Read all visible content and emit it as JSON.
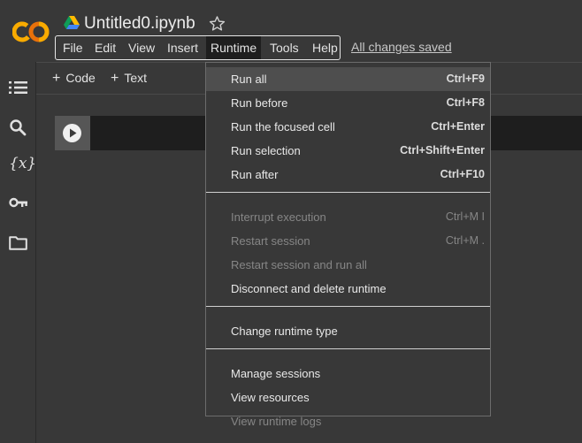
{
  "header": {
    "title": "Untitled0.ipynb",
    "save_status": "All changes saved",
    "menu": [
      "File",
      "Edit",
      "View",
      "Insert",
      "Runtime",
      "Tools",
      "Help"
    ],
    "active_menu": "Runtime"
  },
  "toolbar": {
    "code_label": "Code",
    "text_label": "Text"
  },
  "sidebar": {
    "icons": [
      "table-of-contents-icon",
      "search-icon",
      "variables-icon",
      "secrets-key-icon",
      "files-folder-icon"
    ],
    "variables_glyph": "{x}"
  },
  "runtime_menu": {
    "groups": [
      [
        {
          "label": "Run all",
          "shortcut": "Ctrl+F9",
          "enabled": true,
          "highlighted": true
        },
        {
          "label": "Run before",
          "shortcut": "Ctrl+F8",
          "enabled": true
        },
        {
          "label": "Run the focused cell",
          "shortcut": "Ctrl+Enter",
          "enabled": true
        },
        {
          "label": "Run selection",
          "shortcut": "Ctrl+Shift+Enter",
          "enabled": true
        },
        {
          "label": "Run after",
          "shortcut": "Ctrl+F10",
          "enabled": true
        }
      ],
      [
        {
          "label": "Interrupt execution",
          "shortcut": "Ctrl+M I",
          "enabled": false
        },
        {
          "label": "Restart session",
          "shortcut": "Ctrl+M .",
          "enabled": false
        },
        {
          "label": "Restart session and run all",
          "shortcut": "",
          "enabled": false
        },
        {
          "label": "Disconnect and delete runtime",
          "shortcut": "",
          "enabled": true
        }
      ],
      [
        {
          "label": "Change runtime type",
          "shortcut": "",
          "enabled": true
        }
      ],
      [
        {
          "label": "Manage sessions",
          "shortcut": "",
          "enabled": true
        },
        {
          "label": "View resources",
          "shortcut": "",
          "enabled": true
        },
        {
          "label": "View runtime logs",
          "shortcut": "",
          "enabled": false
        }
      ]
    ]
  },
  "colors": {
    "logo_orange": "#f9ab00",
    "logo_orange_dark": "#e8710a",
    "background": "#383838",
    "cell_background": "#1e1e1e"
  }
}
